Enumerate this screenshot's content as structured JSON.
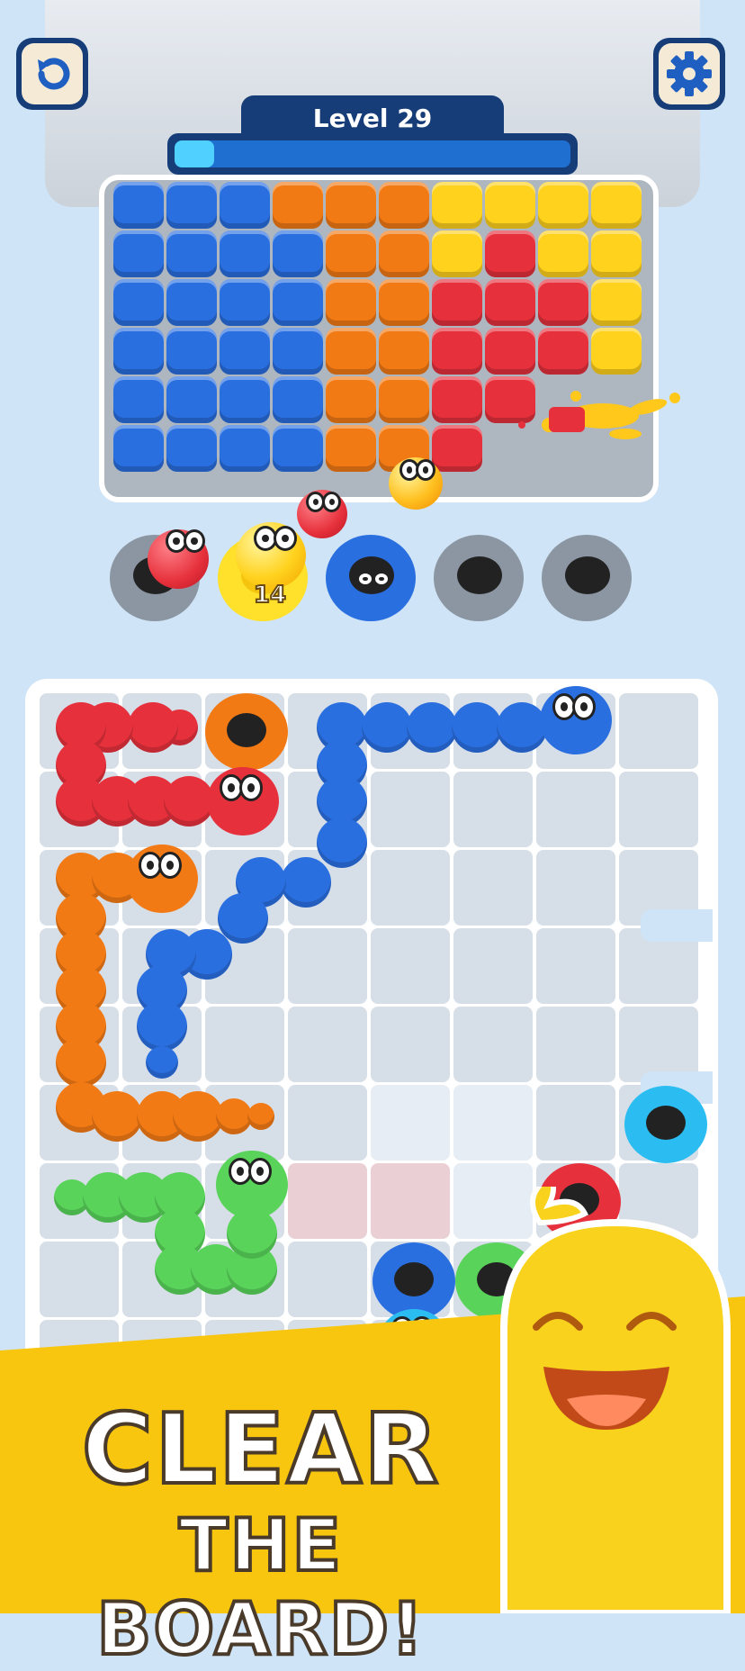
{
  "header": {
    "restart_icon": "restart-icon",
    "settings_icon": "gear-icon",
    "level_label": "Level 29",
    "progress": 0.1
  },
  "ball_counter": "14",
  "headline": {
    "line1": "CLEAR",
    "line2": "THE BOARD!"
  },
  "colors": {
    "blue": "#2a6fe0",
    "orange": "#f27a15",
    "yellow": "#ffd21e",
    "red": "#e6313c",
    "green": "#59d35a",
    "cyan": "#2bbdf2"
  }
}
